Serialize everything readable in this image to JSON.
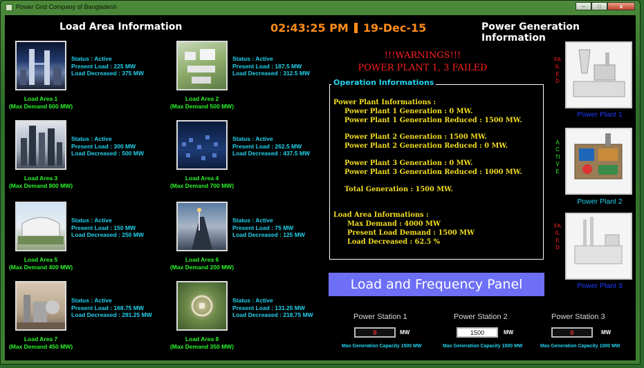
{
  "window": {
    "title": "Power Grid Company of Bangladesh",
    "min_glyph": "–",
    "max_glyph": "□",
    "close_glyph": "x"
  },
  "header": {
    "load_area_title": "Load Area Information",
    "time": "02:43:25 PM",
    "date": "19-Dec-15",
    "power_gen_title": "Power Generation Information"
  },
  "load_areas": [
    {
      "name": "Load Area 1",
      "max_demand": "(Max Demand 600 MW)",
      "status": "Status : Active",
      "present": "Present Load : 225 MW",
      "decreased": "Load Decreased : 375 MW"
    },
    {
      "name": "Load Area 2",
      "max_demand": "(Max Demand 500 MW)",
      "status": "Status : Active",
      "present": "Present Load : 187.5 MW",
      "decreased": "Load Decreased : 312.5 MW"
    },
    {
      "name": "Load Area 3",
      "max_demand": "(Max Demand 800 MW)",
      "status": "Status : Active",
      "present": "Present Load : 300 MW",
      "decreased": "Load Decreased : 500 MW"
    },
    {
      "name": "Load Area 4",
      "max_demand": "(Max Demand 700 MW)",
      "status": "Status : Active",
      "present": "Present Load : 262.5 MW",
      "decreased": "Load Decreased : 437.5 MW"
    },
    {
      "name": "Load Area 5",
      "max_demand": "(Max Demand 400 MW)",
      "status": "Status : Active",
      "present": "Present Load : 150 MW",
      "decreased": "Load Decreased : 250 MW"
    },
    {
      "name": "Load Area 6",
      "max_demand": "(Max Demand 200 MW)",
      "status": "Status : Active",
      "present": "Present Load : 75 MW",
      "decreased": "Load Decreased : 125 MW"
    },
    {
      "name": "Load Area 7",
      "max_demand": "(Max Demand 450 MW)",
      "status": "Status : Active",
      "present": "Present Load : 168.75 MW",
      "decreased": "Load Decreased : 281.25 MW"
    },
    {
      "name": "Load Area 8",
      "max_demand": "(Max Demand 350 MW)",
      "status": "Status : Active",
      "present": "Present Load : 131.25 MW",
      "decreased": "Load Decreased : 218.75 MW"
    }
  ],
  "warnings": {
    "title": "!!!WARNINGS!!!",
    "message": "POWER PLANT 1, 3  FAILED"
  },
  "operation": {
    "legend": "Operation Informations",
    "lines": [
      "Power Plant Informations :",
      "Power Plant 1 Generation : 0 MW.",
      "Power Plant 1 Generation Reduced : 1500 MW.",
      "Power Plant 2 Generation : 1500 MW.",
      "Power Plant 2 Generation Reduced : 0 MW.",
      "Power Plant 3 Generation : 0 MW.",
      "Power Plant 3 Generation Reduced : 1000 MW.",
      "Total Generation : 1500 MW.",
      "Load Area Informations :",
      "Max Demand : 4000 MW",
      "Present Load Demand : 1500 MW",
      "Load Decreased : 62.5 %"
    ]
  },
  "power_plants": [
    {
      "label": "Power Plant 1",
      "state": "FAILED",
      "state_color": "#ff2020",
      "label_color": "#1f3cff"
    },
    {
      "label": "Power Plant 2",
      "state": "ACTIVE",
      "state_color": "#2bf52b",
      "label_color": "#22d3ee"
    },
    {
      "label": "Power Plant 3",
      "state": "FAILED",
      "state_color": "#ff2020",
      "label_color": "#1f3cff"
    }
  ],
  "panel": {
    "title": "Load  and Frequency Panel"
  },
  "stations": [
    {
      "title": "Power Station 1",
      "value": "0",
      "unit": "MW",
      "capacity": "Max Generation Capacity 1500 MW",
      "active": false
    },
    {
      "title": "Power Station 2",
      "value": "1500",
      "unit": "MW",
      "capacity": "Max Generation Capacity 1500 MW",
      "active": true
    },
    {
      "title": "Power Station 3",
      "value": "0",
      "unit": "MW",
      "capacity": "Max Generation Capacity 1000 MW",
      "active": false
    }
  ]
}
